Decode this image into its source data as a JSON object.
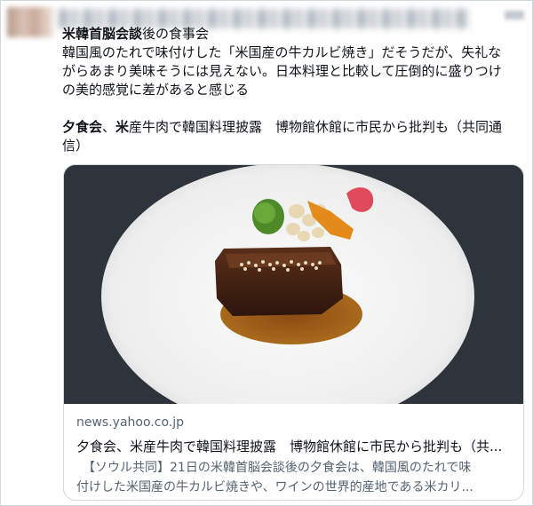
{
  "tweet": {
    "lines": [
      {
        "bold": "米韓首脳会談",
        "rest": "後の食事会"
      },
      {
        "text": "韓国風のたれで味付けした「米国産の牛カルビ焼き」だそうだが、失礼な"
      },
      {
        "text": "がらあまり美味そうには見えない。日本料理と比較して圧倒的に盛りつけ"
      },
      {
        "text": "の美的感覚に差があると感じる"
      }
    ],
    "quote_line1": {
      "bold1": "夕食会",
      "sep": "、",
      "bold2": "米",
      "rest": "産牛肉で韓国料理披露　博物館休館に市民から批判も（共同通"
    },
    "quote_line2": "信）"
  },
  "card": {
    "image_alt": "plated beef dish",
    "domain": "news.yahoo.co.jp",
    "title": "夕食会、米産牛肉で韓国料理披露　博物館休館に市民から批判も（共...",
    "desc_line1": "　【ソウル共同】21日の米韓首脳会談後の夕食会は、韓国風のたれで味",
    "desc_line2": "付けした米国産の牛カルビ焼きや、ワインの世界的産地である米カリ..."
  },
  "colors": {
    "text": "#0f1419",
    "muted": "#536471",
    "border": "#cfd9de"
  }
}
